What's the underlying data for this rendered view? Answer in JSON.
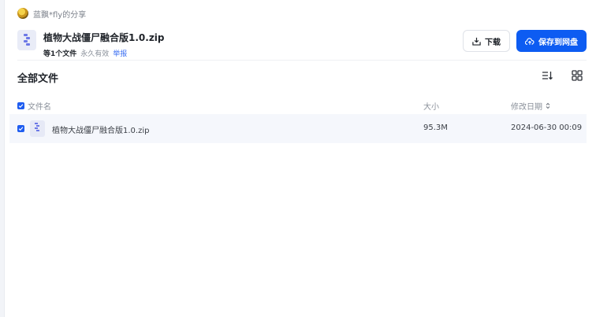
{
  "sharer": {
    "text": "蓝飘*fly的分享"
  },
  "file": {
    "title": "植物大战僵尸融合版1.0.zip",
    "count": "等1个文件",
    "validity": "永久有效",
    "report": "举报"
  },
  "actions": {
    "download": "下载",
    "save": "保存到网盘"
  },
  "section": {
    "title": "全部文件"
  },
  "table": {
    "headers": {
      "name": "文件名",
      "size": "大小",
      "date": "修改日期"
    },
    "rows": [
      {
        "name": "植物大战僵尸融合版1.0.zip",
        "size": "95.3M",
        "date": "2024-06-30 00:09"
      }
    ]
  },
  "colors": {
    "accent": "#0d5cf2",
    "row_bg": "#f5f7fc",
    "link": "#3a6ef2"
  }
}
